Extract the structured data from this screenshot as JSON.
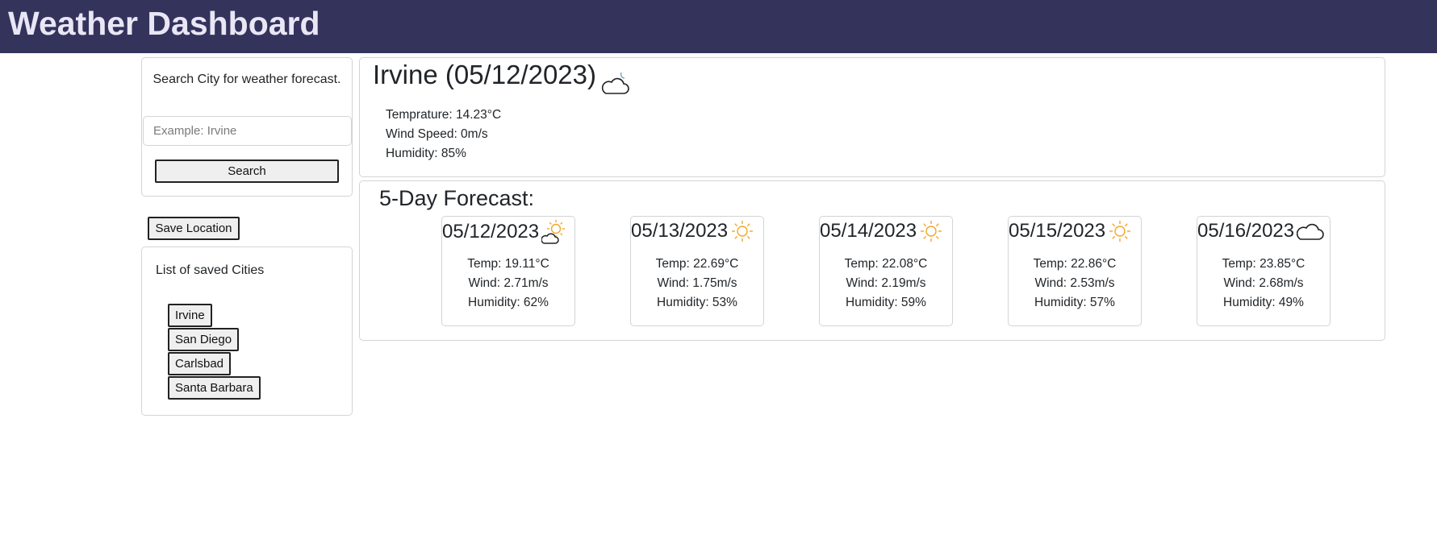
{
  "header": {
    "title": "Weather Dashboard"
  },
  "search": {
    "prompt": "Search City for weather forecast.",
    "placeholder": "Example: Irvine",
    "button_label": "Search"
  },
  "save_button_label": "Save Location",
  "saved": {
    "title": "List of saved Cities",
    "cities": [
      "Irvine",
      "San Diego",
      "Carlsbad",
      "Santa Barbara"
    ]
  },
  "current": {
    "title": "Irvine (05/12/2023)",
    "icon": "night-cloud-icon",
    "temperature": "Temprature: 14.23°C",
    "wind": "Wind Speed: 0m/s",
    "humidity": "Humidity: 85%"
  },
  "forecast": {
    "title": "5-Day Forecast:",
    "days": [
      {
        "date": "05/12/2023",
        "icon": "sun-cloud-icon",
        "temp": "Temp: 19.11°C",
        "wind": "Wind: 2.71m/s",
        "humidity": "Humidity: 62%"
      },
      {
        "date": "05/13/2023",
        "icon": "sun-icon",
        "temp": "Temp: 22.69°C",
        "wind": "Wind: 1.75m/s",
        "humidity": "Humidity: 53%"
      },
      {
        "date": "05/14/2023",
        "icon": "sun-icon",
        "temp": "Temp: 22.08°C",
        "wind": "Wind: 2.19m/s",
        "humidity": "Humidity: 59%"
      },
      {
        "date": "05/15/2023",
        "icon": "sun-icon",
        "temp": "Temp: 22.86°C",
        "wind": "Wind: 2.53m/s",
        "humidity": "Humidity: 57%"
      },
      {
        "date": "05/16/2023",
        "icon": "cloud-icon",
        "temp": "Temp: 23.85°C",
        "wind": "Wind: 2.68m/s",
        "humidity": "Humidity: 49%"
      }
    ]
  },
  "colors": {
    "header_bg": "#33335c",
    "header_text": "#e9e6f5",
    "sun": "#f5a623",
    "card_border": "#d4d4d4"
  }
}
